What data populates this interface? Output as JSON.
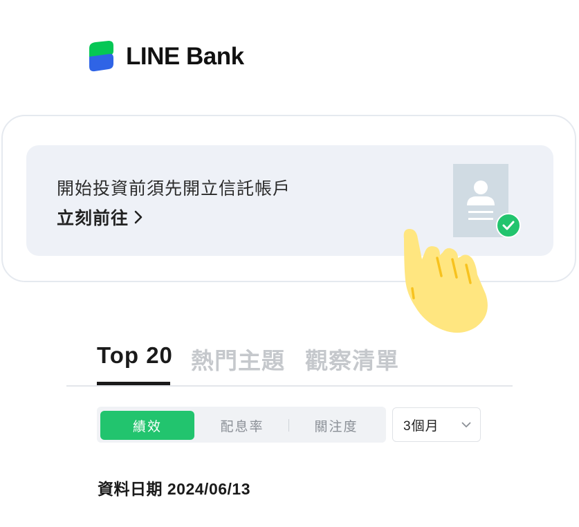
{
  "brand": {
    "name": "LINE Bank",
    "green": "#06c755",
    "blue": "#2f64e6"
  },
  "banner": {
    "title": "開始投資前須先開立信託帳戶",
    "link_label": "立刻前往",
    "link_icon": "chevron-right-icon",
    "illustration": [
      "id-document-icon",
      "check-circle-icon",
      "pointing-hand-icon"
    ]
  },
  "tabs": [
    {
      "label": "Top 20",
      "active": true
    },
    {
      "label": "熱門主題",
      "active": false
    },
    {
      "label": "觀察清單",
      "active": false
    }
  ],
  "filters": {
    "segments": [
      {
        "label": "績效",
        "active": true
      },
      {
        "label": "配息率",
        "active": false
      },
      {
        "label": "關注度",
        "active": false
      }
    ],
    "period": {
      "selected": "3個月",
      "icon": "chevron-down-icon"
    }
  },
  "data_date": "資料日期 2024/06/13",
  "colors": {
    "accent": "#22c46e",
    "inactive_text": "#c5c8cc",
    "banner_bg": "#eef1f7"
  }
}
